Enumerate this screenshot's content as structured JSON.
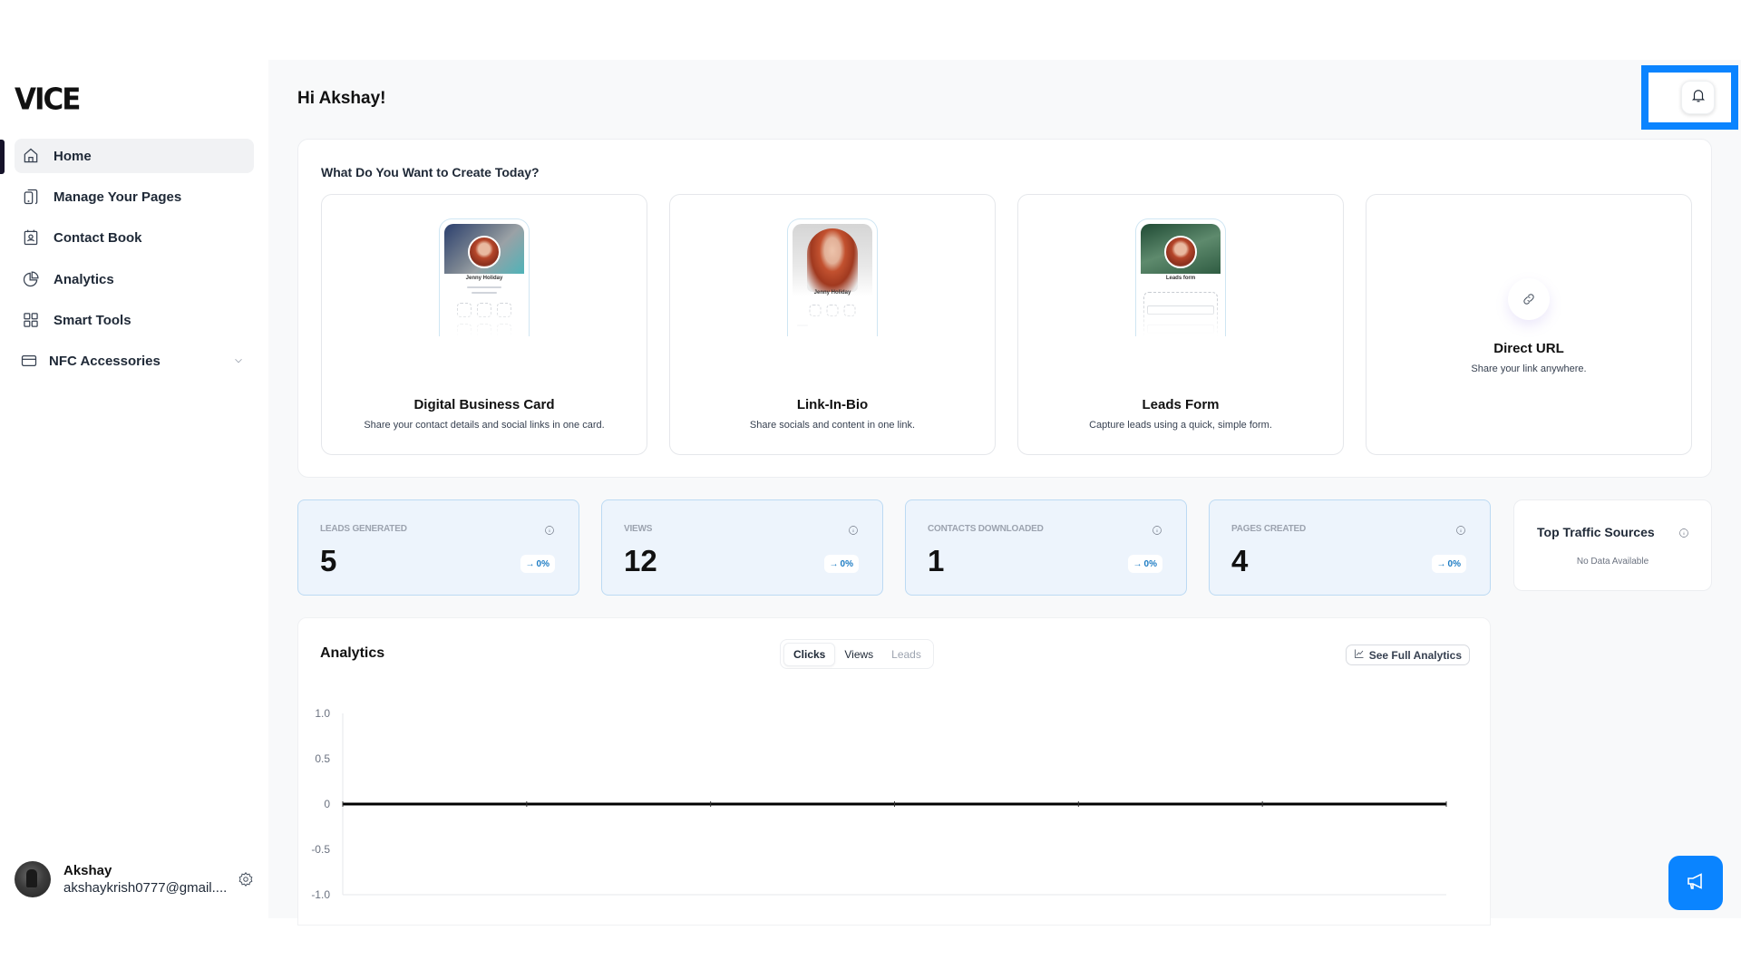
{
  "brand": {
    "logo": "VICE"
  },
  "sidebar": {
    "items": [
      {
        "label": "Home",
        "icon": "home-icon",
        "active": true
      },
      {
        "label": "Manage Your Pages",
        "icon": "pages-icon"
      },
      {
        "label": "Contact Book",
        "icon": "contact-book-icon"
      },
      {
        "label": "Analytics",
        "icon": "pie-chart-icon"
      },
      {
        "label": "Smart Tools",
        "icon": "grid-icon"
      },
      {
        "label": "NFC Accessories",
        "icon": "card-icon",
        "expandable": true
      }
    ],
    "user": {
      "name": "Akshay",
      "email": "akshaykrish0777@gmail...."
    }
  },
  "header": {
    "greeting": "Hi Akshay!",
    "notification_icon": "bell-icon"
  },
  "create": {
    "title": "What Do You Want to Create Today?",
    "cards": [
      {
        "title": "Digital Business Card",
        "description": "Share your contact details and social links in one card.",
        "preview_name": "Jenny Holiday"
      },
      {
        "title": "Link-In-Bio",
        "description": "Share socials and content in one link.",
        "preview_name": "Jenny Holiday"
      },
      {
        "title": "Leads Form",
        "description": "Capture leads using a quick, simple form.",
        "preview_name": "Leads form"
      },
      {
        "title": "Direct URL",
        "description": "Share your link anywhere.",
        "icon": "link-icon"
      }
    ]
  },
  "stats": [
    {
      "label": "LEADS GENERATED",
      "value": "5",
      "change": "0%"
    },
    {
      "label": "VIEWS",
      "value": "12",
      "change": "0%"
    },
    {
      "label": "CONTACTS DOWNLOADED",
      "value": "1",
      "change": "0%"
    },
    {
      "label": "PAGES CREATED",
      "value": "4",
      "change": "0%"
    }
  ],
  "traffic": {
    "title": "Top Traffic Sources",
    "empty": "No Data Available"
  },
  "analytics": {
    "title": "Analytics",
    "tabs": [
      {
        "label": "Clicks",
        "active": true
      },
      {
        "label": "Views",
        "active": false
      },
      {
        "label": "Leads",
        "active": false,
        "muted": true
      }
    ],
    "see_full": "See Full Analytics"
  },
  "chart_data": {
    "type": "line",
    "title": "",
    "xlabel": "",
    "ylabel": "",
    "ylim": [
      -1.0,
      1.0
    ],
    "yticks": [
      "1.0",
      "0.5",
      "0",
      "-0.5",
      "-1.0"
    ],
    "ytick_values": [
      1.0,
      0.5,
      0,
      -0.5,
      -1.0
    ],
    "x": [
      0,
      1,
      2,
      3,
      4,
      5,
      6
    ],
    "series": [
      {
        "name": "Clicks",
        "values": [
          0,
          0,
          0,
          0,
          0,
          0,
          0
        ],
        "color": "#000000"
      }
    ],
    "grid": false
  },
  "colors": {
    "accent": "#0a84ff",
    "stat_bg": "#edf4fc",
    "stat_border": "#bcdaf3",
    "badge_text": "#1d7cc4"
  }
}
